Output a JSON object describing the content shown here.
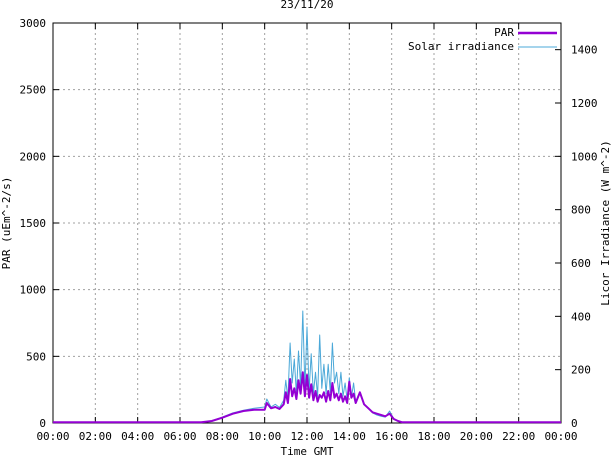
{
  "chart_data": {
    "type": "line",
    "title": "23/11/20",
    "xlabel": "Time GMT",
    "ylabel_left": "PAR (uEm^-2/s)",
    "ylabel_right": "Licor Irradiance (W m^-2)",
    "x_ticks": [
      "00:00",
      "02:00",
      "04:00",
      "06:00",
      "08:00",
      "10:00",
      "12:00",
      "14:00",
      "16:00",
      "18:00",
      "20:00",
      "22:00",
      "00:00"
    ],
    "y_left_ticks": [
      "0",
      "500",
      "1000",
      "1500",
      "2000",
      "2500",
      "3000"
    ],
    "y_right_ticks": [
      "0",
      "200",
      "400",
      "600",
      "800",
      "1000",
      "1200",
      "1400"
    ],
    "xlim_hours": [
      0,
      24
    ],
    "ylim_left": [
      0,
      3000
    ],
    "ylim_right": [
      0,
      1500
    ],
    "grid": true,
    "legend_position": "top-right",
    "series": [
      {
        "name": "PAR",
        "axis": "left",
        "color": "#9400d3",
        "x": [
          0,
          7.0,
          7.5,
          8.0,
          8.5,
          9.0,
          9.5,
          10.0,
          10.1,
          10.3,
          10.5,
          10.7,
          10.9,
          11.0,
          11.1,
          11.2,
          11.3,
          11.4,
          11.5,
          11.6,
          11.7,
          11.8,
          11.9,
          12.0,
          12.1,
          12.2,
          12.3,
          12.4,
          12.5,
          12.6,
          12.7,
          12.8,
          12.9,
          13.0,
          13.1,
          13.2,
          13.3,
          13.4,
          13.5,
          13.6,
          13.7,
          13.8,
          13.9,
          14.0,
          14.1,
          14.2,
          14.3,
          14.5,
          14.7,
          14.9,
          15.1,
          15.3,
          15.5,
          15.7,
          15.9,
          16.1,
          16.3,
          16.5,
          17.0,
          24
        ],
        "y": [
          5,
          5,
          15,
          40,
          70,
          90,
          100,
          100,
          150,
          110,
          120,
          105,
          140,
          230,
          150,
          330,
          200,
          260,
          180,
          320,
          220,
          380,
          200,
          360,
          190,
          290,
          170,
          240,
          160,
          210,
          190,
          230,
          160,
          240,
          170,
          300,
          190,
          220,
          170,
          220,
          160,
          200,
          150,
          310,
          190,
          220,
          150,
          230,
          140,
          110,
          80,
          70,
          60,
          50,
          70,
          30,
          15,
          5,
          5,
          5
        ]
      },
      {
        "name": "Solar irradiance",
        "axis": "right",
        "color": "#4ba8d8",
        "x": [
          0,
          7.0,
          7.5,
          8.0,
          8.5,
          9.0,
          9.5,
          10.0,
          10.1,
          10.3,
          10.5,
          10.7,
          10.9,
          11.0,
          11.1,
          11.2,
          11.3,
          11.4,
          11.5,
          11.6,
          11.7,
          11.8,
          11.9,
          12.0,
          12.1,
          12.2,
          12.3,
          12.4,
          12.5,
          12.6,
          12.7,
          12.8,
          12.9,
          13.0,
          13.1,
          13.2,
          13.3,
          13.4,
          13.5,
          13.6,
          13.7,
          13.8,
          13.9,
          14.0,
          14.1,
          14.2,
          14.3,
          14.5,
          14.7,
          14.9,
          15.1,
          15.3,
          15.5,
          15.7,
          15.9,
          16.1,
          16.3,
          16.5,
          17.0,
          24
        ],
        "y": [
          3,
          3,
          8,
          22,
          38,
          48,
          55,
          60,
          90,
          60,
          70,
          58,
          85,
          160,
          90,
          300,
          150,
          240,
          110,
          270,
          140,
          420,
          130,
          360,
          120,
          260,
          110,
          190,
          100,
          330,
          130,
          220,
          110,
          220,
          115,
          300,
          150,
          190,
          110,
          190,
          100,
          150,
          85,
          170,
          95,
          150,
          80,
          110,
          70,
          55,
          38,
          30,
          25,
          22,
          45,
          15,
          8,
          3,
          3,
          3
        ]
      }
    ]
  }
}
